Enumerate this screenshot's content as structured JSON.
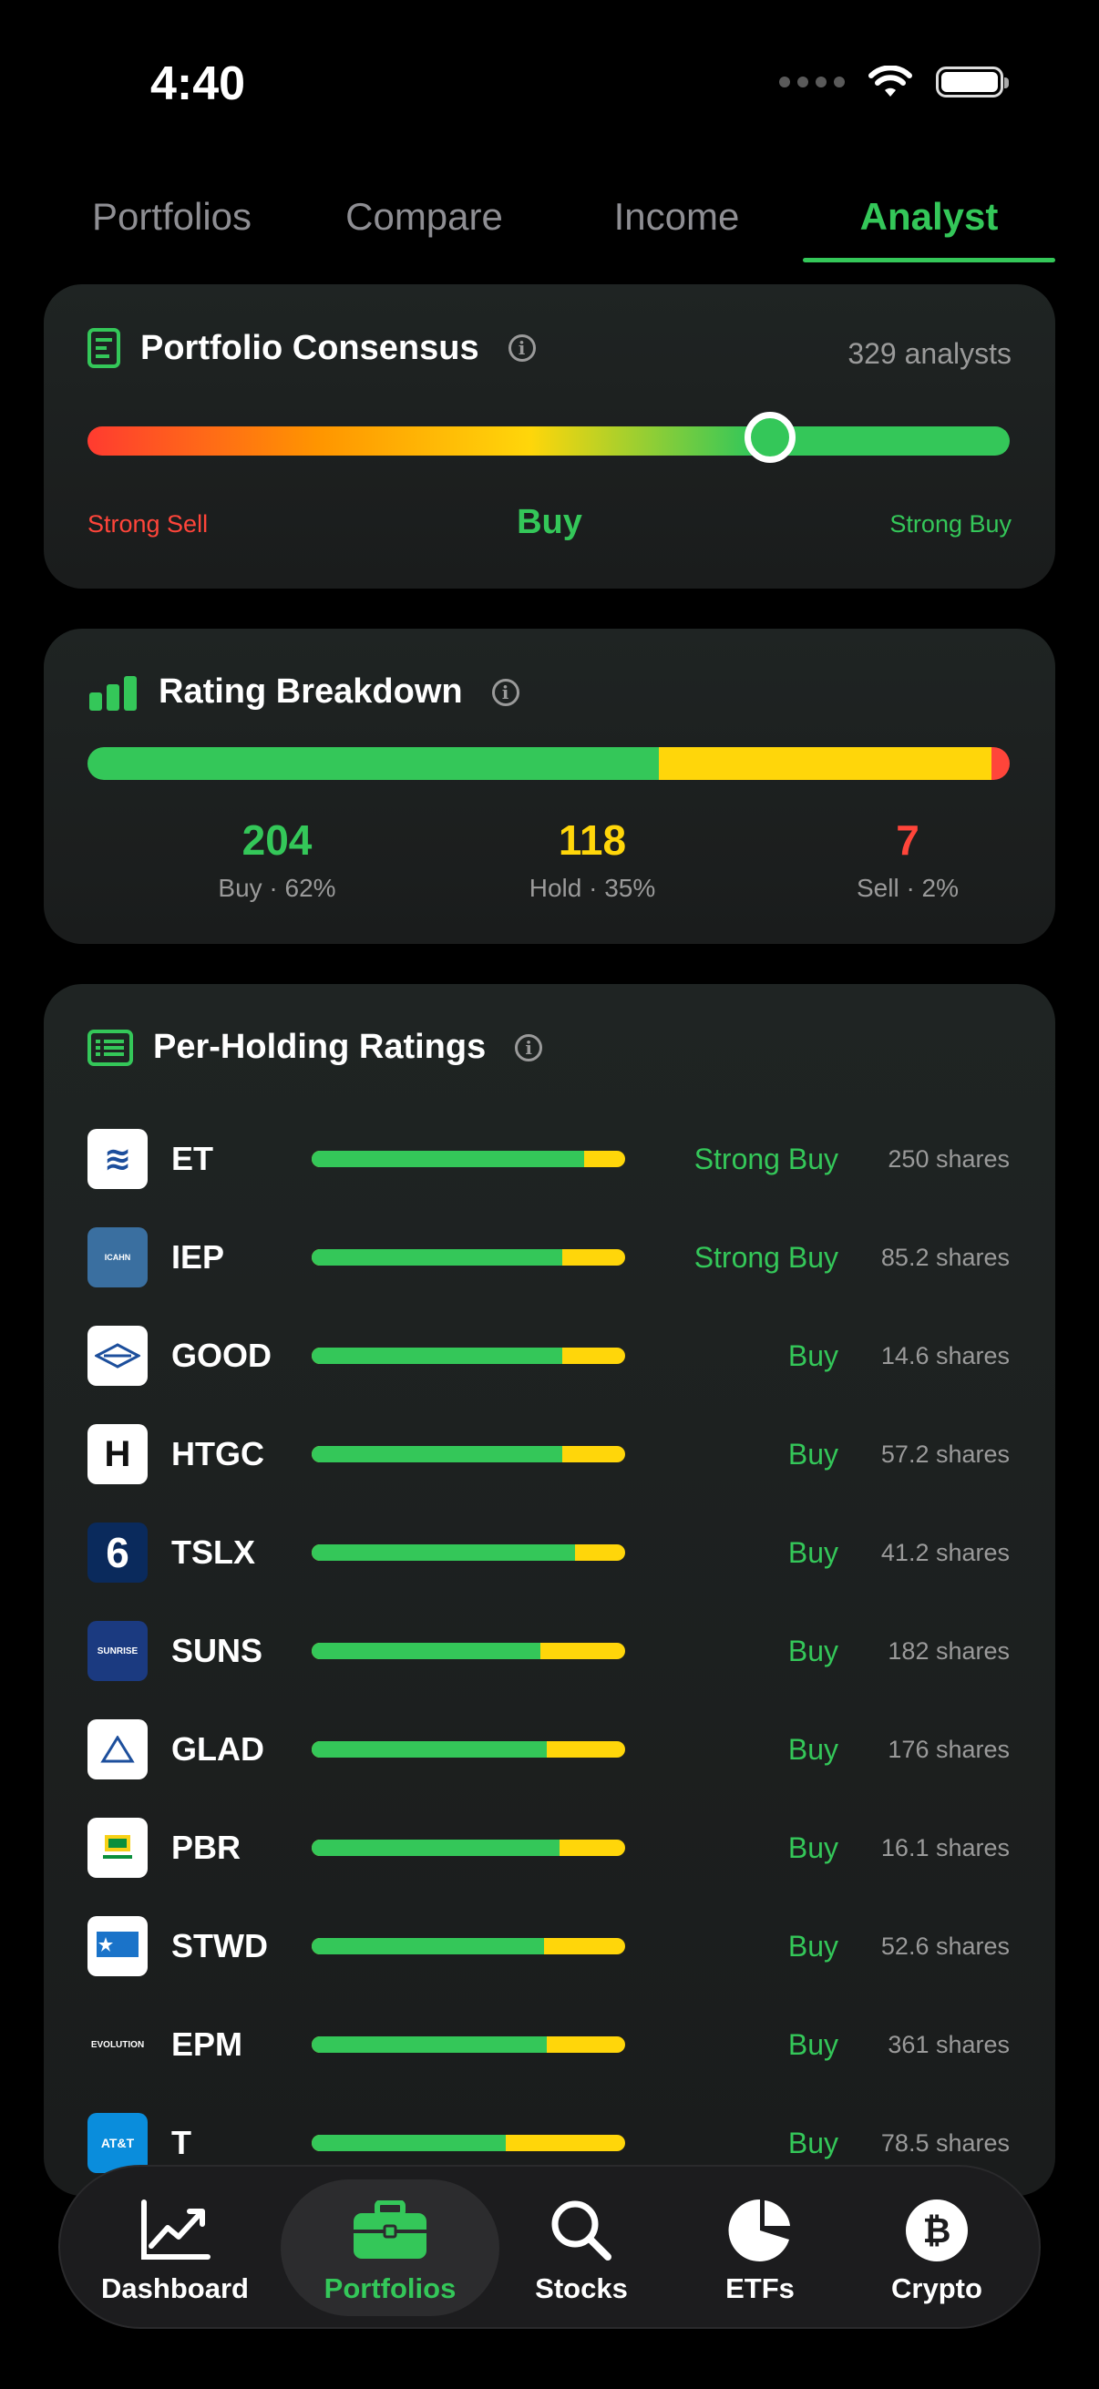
{
  "status": {
    "time": "4:40"
  },
  "tabs": [
    {
      "label": "Portfolios"
    },
    {
      "label": "Compare"
    },
    {
      "label": "Income"
    },
    {
      "label": "Analyst"
    }
  ],
  "consensus": {
    "title": "Portfolio Consensus",
    "analysts": "329 analysts",
    "position": 0.74,
    "strong_sell_label": "Strong Sell",
    "value_label": "Buy",
    "strong_buy_label": "Strong Buy"
  },
  "breakdown": {
    "title": "Rating Breakdown",
    "buy_fraction": 0.62,
    "hold_fraction": 0.36,
    "sell_fraction": 0.02,
    "buy": {
      "count": "204",
      "label": "Buy · 62%"
    },
    "hold": {
      "count": "118",
      "label": "Hold · 35%"
    },
    "sell": {
      "count": "7",
      "label": "Sell · 2%"
    }
  },
  "holdings": {
    "title": "Per-Holding Ratings",
    "items": [
      {
        "ticker": "ET",
        "buy_fraction": 0.87,
        "rating": "Strong Buy",
        "shares": "250 shares"
      },
      {
        "ticker": "IEP",
        "buy_fraction": 0.8,
        "rating": "Strong Buy",
        "shares": "85.2 shares"
      },
      {
        "ticker": "GOOD",
        "buy_fraction": 0.8,
        "rating": "Buy",
        "shares": "14.6 shares"
      },
      {
        "ticker": "HTGC",
        "buy_fraction": 0.8,
        "rating": "Buy",
        "shares": "57.2 shares"
      },
      {
        "ticker": "TSLX",
        "buy_fraction": 0.84,
        "rating": "Buy",
        "shares": "41.2 shares"
      },
      {
        "ticker": "SUNS",
        "buy_fraction": 0.73,
        "rating": "Buy",
        "shares": "182 shares"
      },
      {
        "ticker": "GLAD",
        "buy_fraction": 0.75,
        "rating": "Buy",
        "shares": "176 shares"
      },
      {
        "ticker": "PBR",
        "buy_fraction": 0.79,
        "rating": "Buy",
        "shares": "16.1 shares"
      },
      {
        "ticker": "STWD",
        "buy_fraction": 0.74,
        "rating": "Buy",
        "shares": "52.6 shares"
      },
      {
        "ticker": "EPM",
        "buy_fraction": 0.75,
        "rating": "Buy",
        "shares": "361 shares"
      },
      {
        "ticker": "T",
        "buy_fraction": 0.62,
        "rating": "Buy",
        "shares": "78.5 shares"
      }
    ]
  },
  "nav": [
    {
      "label": "Dashboard"
    },
    {
      "label": "Portfolios"
    },
    {
      "label": "Stocks"
    },
    {
      "label": "ETFs"
    },
    {
      "label": "Crypto"
    }
  ],
  "colors": {
    "accent": "#34c759",
    "hold": "#ffd60a",
    "sell": "#ff453a"
  }
}
